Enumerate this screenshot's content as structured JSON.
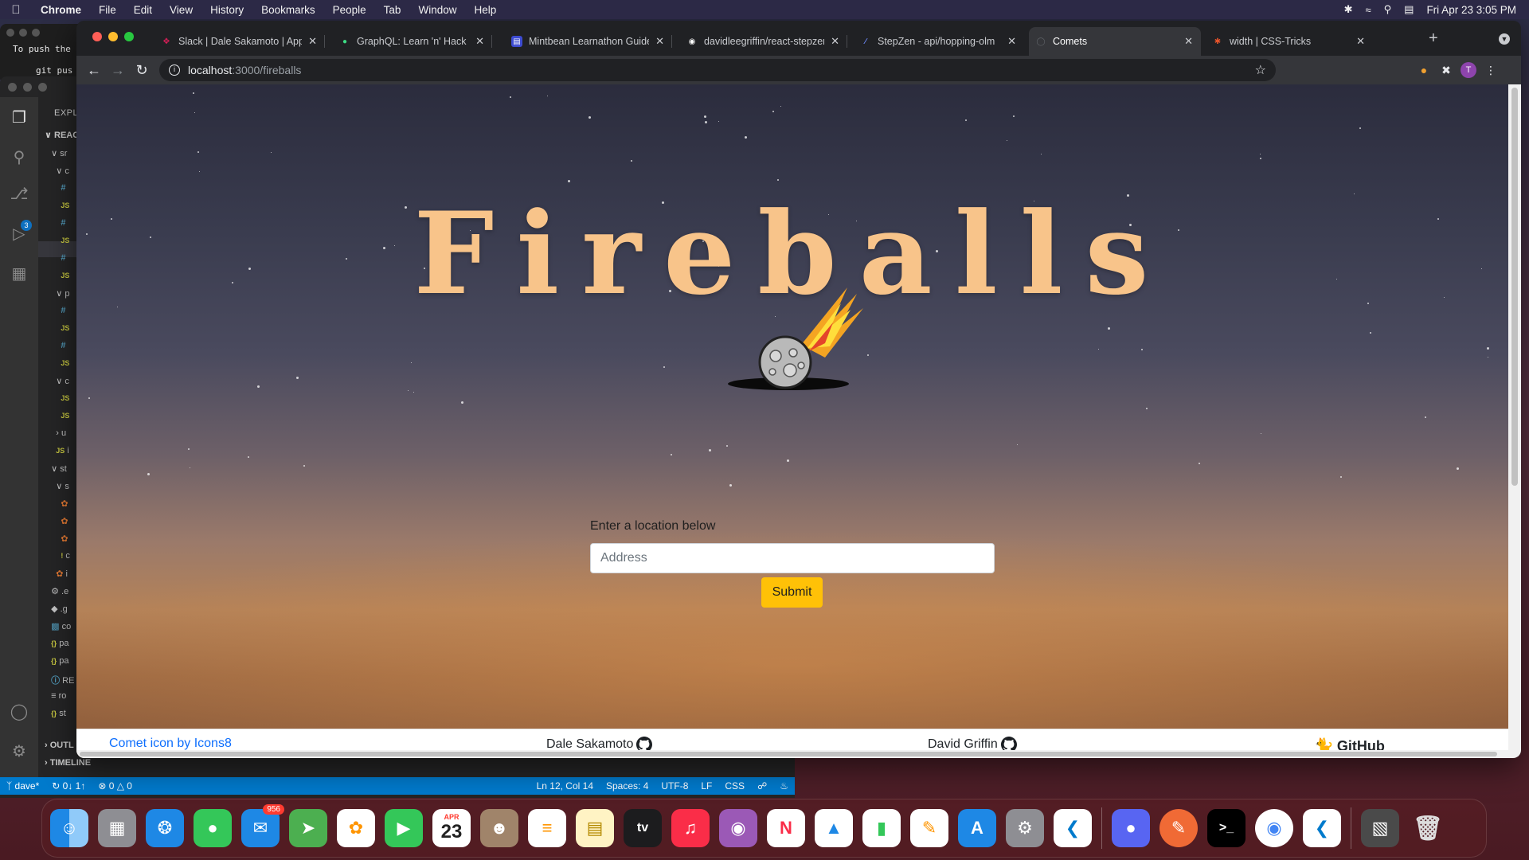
{
  "menubar": {
    "app": "Chrome",
    "items": [
      "File",
      "Edit",
      "View",
      "History",
      "Bookmarks",
      "People",
      "Tab",
      "Window",
      "Help"
    ],
    "clock": "Fri Apr 23  3:05 PM"
  },
  "terminal": {
    "line1": "To push the",
    "line2": "git pus"
  },
  "vscode": {
    "explorer_title": "EXPL",
    "root": "REAC",
    "scm_badge": "3",
    "outline": "OUTL",
    "timeline": "TIMELINE",
    "status": {
      "branch": "dave*",
      "sync": "0↓ 1↑",
      "problems": "0 △ 0",
      "position": "Ln 12, Col 14",
      "spaces": "Spaces: 4",
      "encoding": "UTF-8",
      "eol": "LF",
      "language": "CSS"
    }
  },
  "browser": {
    "tabs": [
      {
        "title": "Slack | Dale Sakamoto | App",
        "icon": "slack-icon",
        "color": "#e01e5a",
        "active": false
      },
      {
        "title": "GraphQL: Learn 'n' Hack - m",
        "icon": "graphql-icon",
        "color": "#3ddc84",
        "active": false
      },
      {
        "title": "Mintbean Learnathon Guideb",
        "icon": "mintbean-icon",
        "color": "#3d4bd1",
        "active": false
      },
      {
        "title": "davidleegriffin/react-stepzen",
        "icon": "github-icon",
        "color": "#ffffff",
        "active": false
      },
      {
        "title": "StepZen - api/hopping-olm",
        "icon": "stepzen-icon",
        "color": "#6f8cff",
        "active": false
      },
      {
        "title": "Comets",
        "icon": "globe-icon",
        "color": "#5f6368",
        "active": true
      },
      {
        "title": "width | CSS-Tricks",
        "icon": "csstricks-icon",
        "color": "#e8542b",
        "active": false
      }
    ],
    "url_host": "localhost",
    "url_path": ":3000/fireballs",
    "profile_initial": "T"
  },
  "page": {
    "title": "Fireballs",
    "form_label": "Enter a location below",
    "address_placeholder": "Address",
    "submit_label": "Submit",
    "footer": {
      "credit": "Comet icon by Icons8",
      "author1": "Dale Sakamoto",
      "author2": "David Griffin",
      "github": "GitHub"
    }
  },
  "dock": {
    "mail_badge": "956",
    "calendar_month": "APR",
    "calendar_day": "23",
    "tv_label": "tv"
  }
}
